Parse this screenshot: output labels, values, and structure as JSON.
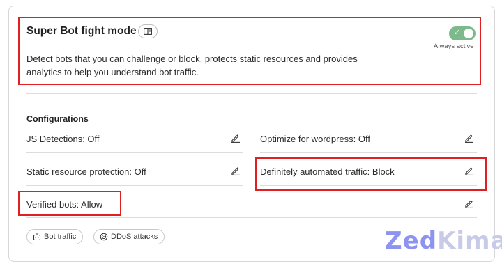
{
  "header": {
    "title": "Super Bot fight mode",
    "description": "Detect bots that you can challenge or block, protects static resources and provides analytics to help you understand bot traffic.",
    "toggle_caption": "Always active",
    "toggle_state": "on",
    "toggle_check": "✓"
  },
  "configurations": {
    "heading": "Configurations",
    "items": [
      {
        "label": "JS Detections: Off"
      },
      {
        "label": "Optimize for wordpress: Off"
      },
      {
        "label": "Static resource protection: Off"
      },
      {
        "label": "Definitely automated traffic: Block"
      },
      {
        "label": "Verified bots: Allow"
      }
    ]
  },
  "links": [
    {
      "label": "Bot traffic",
      "icon": "robot-icon"
    },
    {
      "label": "DDoS attacks",
      "icon": "shield-target-icon"
    }
  ],
  "watermark": {
    "part1": "Zed",
    "part2": "Kima"
  },
  "colors": {
    "accent": "#7cba8b",
    "highlight": "#e02020",
    "watermark_primary": "#8d93f0",
    "watermark_secondary": "#c7cbe8"
  }
}
